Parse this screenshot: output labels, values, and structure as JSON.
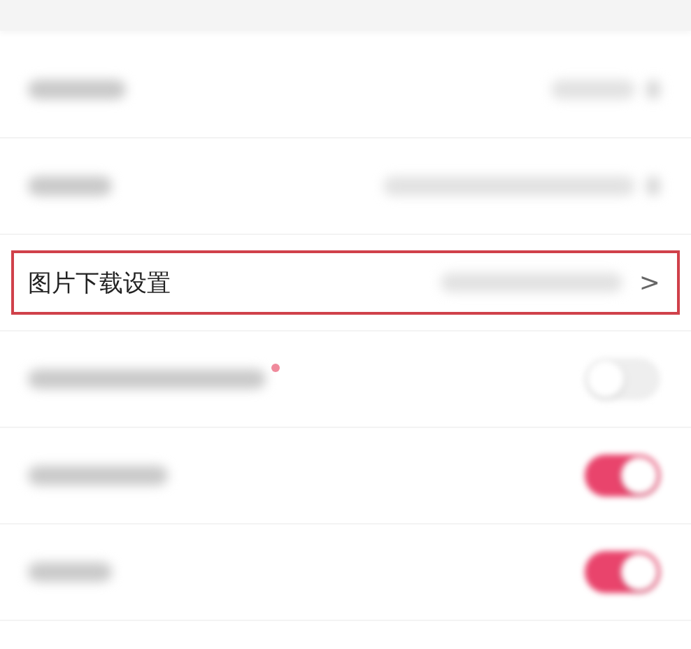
{
  "settings": [
    {
      "kind": "link",
      "highlighted": false
    },
    {
      "kind": "link",
      "highlighted": false
    },
    {
      "kind": "link",
      "highlighted": true,
      "label": "图片下载设置",
      "chevron": ">"
    },
    {
      "kind": "toggle",
      "highlighted": false,
      "dot": true,
      "on": false
    },
    {
      "kind": "toggle",
      "highlighted": false,
      "on": true
    },
    {
      "kind": "toggle",
      "highlighted": false,
      "on": true
    }
  ]
}
